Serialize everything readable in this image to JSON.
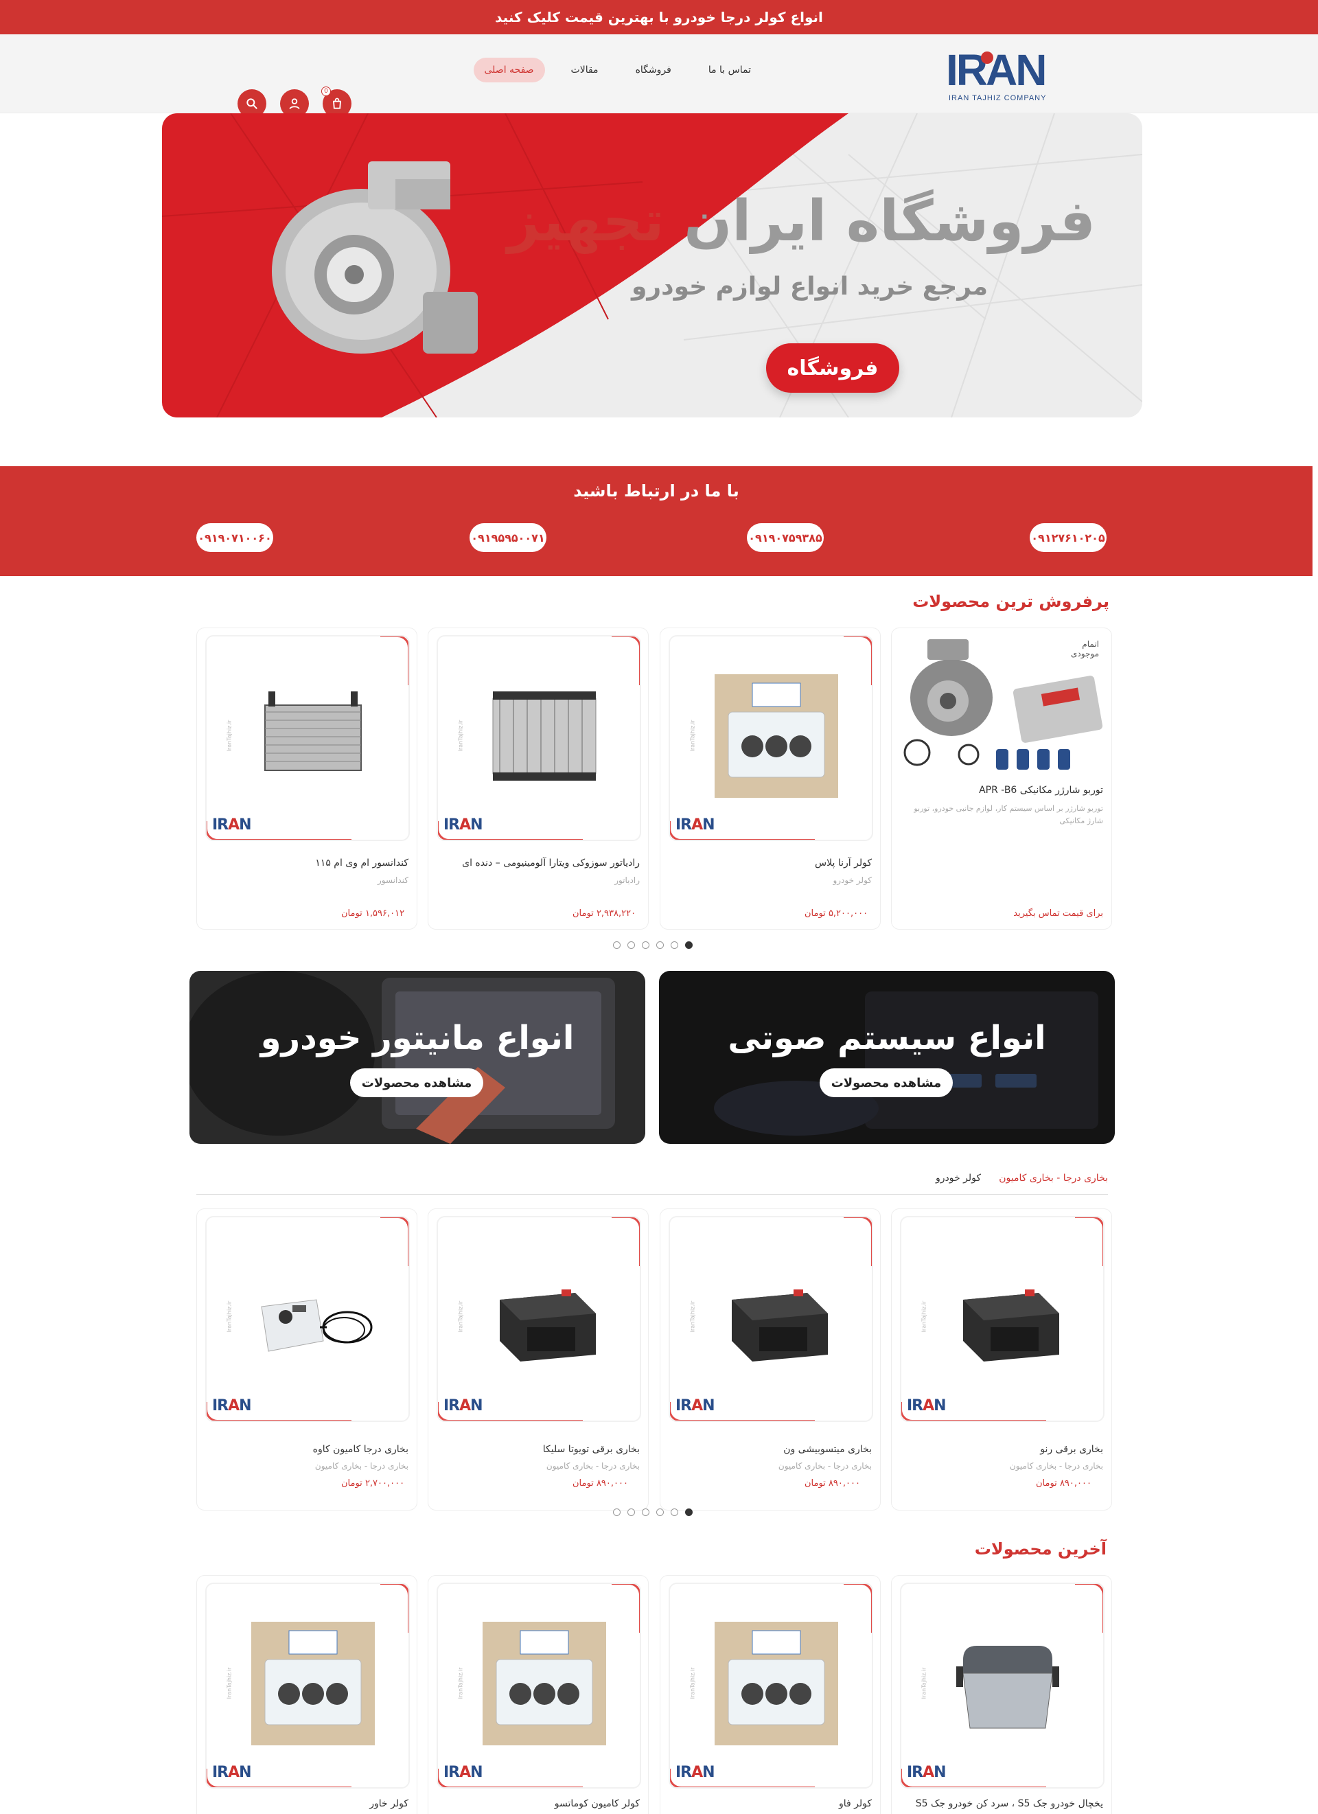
{
  "topbar": {
    "promo": "انواع کولر درجا خودرو با بهترین قیمت کلیک کنید"
  },
  "header": {
    "logo_text": "IRAN",
    "logo_sub": "IRAN TAJHIZ COMPANY",
    "nav": [
      "صفحه اصلی",
      "مقالات",
      "فروشگاه",
      "تماس با ما"
    ],
    "cart_count": "0"
  },
  "hero": {
    "title_gray": "فروشگاه ایران",
    "title_red": "تجهیز",
    "subtitle": "مرجع خرید انواع لوازم خودرو",
    "button": "فروشگاه"
  },
  "contact": {
    "title": "با ما در ارتباط باشید",
    "phones": [
      "۰۹۱۲۷۶۱۰۲۰۵",
      "۰۹۱۹۰۷۵۹۳۸۵",
      "۰۹۱۹۵۹۵۰۰۷۱",
      "۰۹۱۹۰۷۱۰۰۶۰"
    ]
  },
  "bestsellers": {
    "title": "پرفروش ترین محصولات",
    "products": [
      {
        "stock": "اتمام موجودی",
        "name": "توربو شارژر مکانیکی APR -B6",
        "desc": "توربو شارژر بر اساس سیستم کار، لوازم جانبی خودرو، توربو شارژ مکانیکی",
        "price": "برای قیمت تماس بگیرید"
      },
      {
        "name": "کولر آرنا پلاس",
        "category": "کولر خودرو",
        "price": "۵,۲۰۰,۰۰۰ تومان"
      },
      {
        "name": "رادیاتور سوزوکی ویتارا آلومینیومی – دنده ای",
        "category": "رادیاتور",
        "price": "۲,۹۳۸,۲۲۰ تومان"
      },
      {
        "name": "کندانسور ام وی ام ۱۱۵",
        "category": "کندانسور",
        "price": "۱,۵۹۶,۰۱۲ تومان"
      }
    ]
  },
  "banners": [
    {
      "title": "انواع سیستم صوتی",
      "button": "مشاهده محصولات"
    },
    {
      "title": "انواع مانیتور خودرو",
      "button": "مشاهده محصولات"
    }
  ],
  "tabs": {
    "tab1": "بخاری درجا - بخاری کامیون",
    "tab2": "کولر خودرو"
  },
  "heaters": {
    "products": [
      {
        "name": "بخاری برقی رنو",
        "category": "بخاری درجا - بخاری کامیون",
        "price": "۸۹۰,۰۰۰ تومان"
      },
      {
        "name": "بخاری میتسوبیشی ون",
        "category": "بخاری درجا - بخاری کامیون",
        "price": "۸۹۰,۰۰۰ تومان"
      },
      {
        "name": "بخاری برقی تویوتا سلیکا",
        "category": "بخاری درجا - بخاری کامیون",
        "price": "۸۹۰,۰۰۰ تومان"
      },
      {
        "name": "بخاری درجا کامیون کاوه",
        "category": "بخاری درجا - بخاری کامیون",
        "price": "۲,۷۰۰,۰۰۰ تومان"
      }
    ]
  },
  "latest": {
    "title": "آخرین محصولات",
    "products": [
      {
        "name": "یخچال خودرو جک S5 ، سرد کن خودرو جک S5"
      },
      {
        "name": "کولر فاو"
      },
      {
        "name": "کولر کامیون کوماتسو"
      },
      {
        "name": "کولر خاور"
      }
    ]
  },
  "watermark": "IranTajhiz.ir",
  "colors": {
    "accent": "#cf3431",
    "brand_blue": "#2a4e8a"
  }
}
